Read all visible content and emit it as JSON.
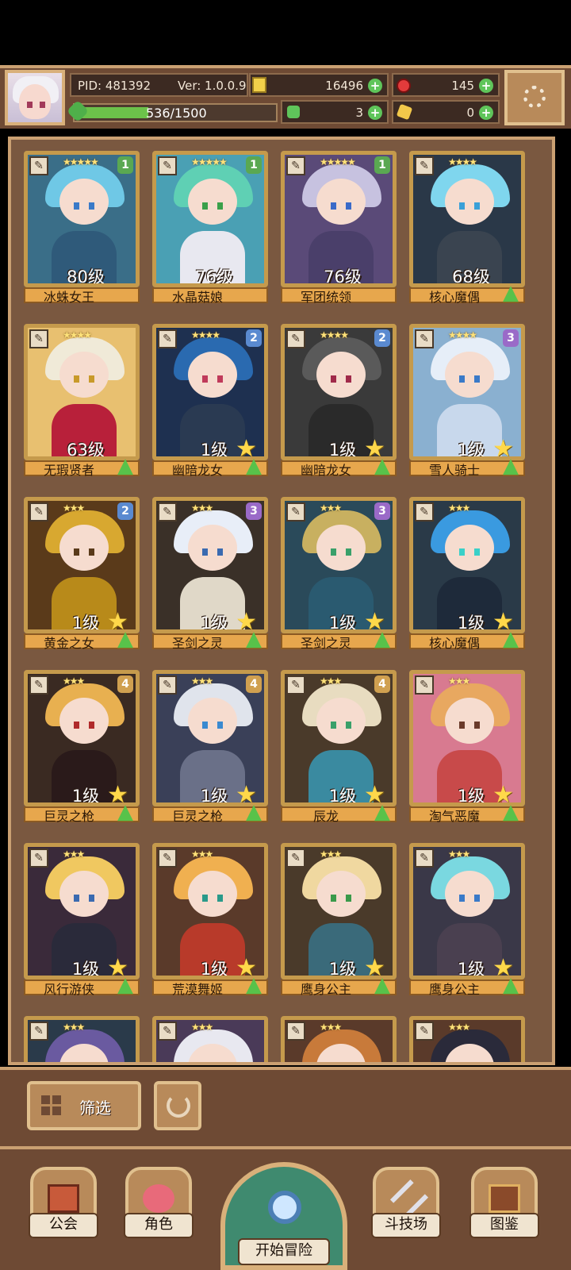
{
  "header": {
    "pid": "PID: 481392",
    "version": "Ver: 1.0.0.9",
    "gold": "16496",
    "gems": "145",
    "clover_count": "3",
    "key_count": "0",
    "exp_text": "536/1500",
    "exp_progress": 0.357
  },
  "cards": [
    {
      "name": "冰蛛女王",
      "level": "80级",
      "rank": "1",
      "rank_color": "#5aa852",
      "stars": "★★★★★",
      "hair": "#6fc8e6",
      "body": "#2f5a7a",
      "bg": "#3a6e88",
      "eye": "#3a7ac8",
      "has_star": false,
      "has_up": false
    },
    {
      "name": "水晶菇娘",
      "level": "76级",
      "rank": "1",
      "rank_color": "#5aa852",
      "stars": "★★★★★",
      "hair": "#5fd0b4",
      "body": "#e8e8f0",
      "bg": "#4aa0b4",
      "eye": "#3aa04a",
      "has_star": false,
      "has_up": false
    },
    {
      "name": "军团统领",
      "level": "76级",
      "rank": "1",
      "rank_color": "#5aa852",
      "stars": "★★★★★",
      "hair": "#c7c2e0",
      "body": "#4a3f6a",
      "bg": "#5a4a78",
      "eye": "#3a6ac8",
      "has_star": false,
      "has_up": false
    },
    {
      "name": "核心魔偶",
      "level": "68级",
      "rank": "",
      "rank_color": "",
      "stars": "★★★★",
      "hair": "#7fd6ee",
      "body": "#3a4450",
      "bg": "#2a3848",
      "eye": "#3aa0d8",
      "has_star": false,
      "has_up": true
    },
    {
      "name": "无瑕贤者",
      "level": "63级",
      "rank": "",
      "rank_color": "",
      "stars": "★★★★",
      "hair": "#f0ead8",
      "body": "#b8203a",
      "bg": "#e8c070",
      "eye": "#c89a2a",
      "has_star": false,
      "has_up": true
    },
    {
      "name": "幽暗龙女",
      "level": "1级",
      "rank": "2",
      "rank_color": "#5a8ad0",
      "stars": "★★★★",
      "hair": "#2a6ab0",
      "body": "#2a3a52",
      "bg": "#1e3050",
      "eye": "#c03a5a",
      "has_star": true,
      "has_up": true
    },
    {
      "name": "幽暗龙女",
      "level": "1级",
      "rank": "2",
      "rank_color": "#5a8ad0",
      "stars": "★★★★",
      "hair": "#5a5a5a",
      "body": "#2a2a2a",
      "bg": "#3a3a3a",
      "eye": "#a02a4a",
      "has_star": true,
      "has_up": true
    },
    {
      "name": "雪人骑士",
      "level": "1级",
      "rank": "3",
      "rank_color": "#9a6ac8",
      "stars": "★★★★",
      "hair": "#e6eef8",
      "body": "#c8d8ec",
      "bg": "#8ab0d0",
      "eye": "#3a7ac8",
      "has_star": true,
      "has_up": true
    },
    {
      "name": "黄金之女",
      "level": "1级",
      "rank": "2",
      "rank_color": "#5a8ad0",
      "stars": "★★★",
      "hair": "#d8a830",
      "body": "#b88a1a",
      "bg": "#5a3a1a",
      "eye": "#5a3a1a",
      "has_star": true,
      "has_up": true
    },
    {
      "name": "圣剑之灵",
      "level": "1级",
      "rank": "3",
      "rank_color": "#9a6ac8",
      "stars": "★★★",
      "hair": "#e8eef8",
      "body": "#e0d8c8",
      "bg": "#3a3028",
      "eye": "#3a6ab0",
      "has_star": true,
      "has_up": true
    },
    {
      "name": "圣剑之灵",
      "level": "1级",
      "rank": "3",
      "rank_color": "#9a6ac8",
      "stars": "★★★",
      "hair": "#c8b060",
      "body": "#2a5a70",
      "bg": "#2a4a5a",
      "eye": "#3aa06a",
      "has_star": true,
      "has_up": true
    },
    {
      "name": "核心魔偶",
      "level": "1级",
      "rank": "",
      "rank_color": "",
      "stars": "★★★",
      "hair": "#3a9ae0",
      "body": "#1e2a3a",
      "bg": "#2a3a48",
      "eye": "#3ad0c8",
      "has_star": true,
      "has_up": true
    },
    {
      "name": "巨灵之枪",
      "level": "1级",
      "rank": "4",
      "rank_color": "#d0a050",
      "stars": "★★★",
      "hair": "#e8b050",
      "body": "#2a1a1a",
      "bg": "#3a2a22",
      "eye": "#b02a2a",
      "has_star": true,
      "has_up": true
    },
    {
      "name": "巨灵之枪",
      "level": "1级",
      "rank": "4",
      "rank_color": "#d0a050",
      "stars": "★★★",
      "hair": "#e0e4ec",
      "body": "#6a7088",
      "bg": "#3a4058",
      "eye": "#3a8ad0",
      "has_star": true,
      "has_up": true
    },
    {
      "name": "辰龙",
      "level": "1级",
      "rank": "4",
      "rank_color": "#d0a050",
      "stars": "★★★",
      "hair": "#e8dcc0",
      "body": "#3a8aa0",
      "bg": "#4a3a2a",
      "eye": "#3aa06a",
      "has_star": true,
      "has_up": true
    },
    {
      "name": "淘气恶魔",
      "level": "1级",
      "rank": "",
      "rank_color": "",
      "stars": "★★★",
      "hair": "#e8a860",
      "body": "#c84a4a",
      "bg": "#d87a90",
      "eye": "#6a3a2a",
      "has_star": true,
      "has_up": true
    },
    {
      "name": "风行游侠",
      "level": "1级",
      "rank": "",
      "rank_color": "",
      "stars": "★★★",
      "hair": "#f0c860",
      "body": "#2a2a3a",
      "bg": "#3a2a3a",
      "eye": "#3a6ab0",
      "has_star": true,
      "has_up": true
    },
    {
      "name": "荒漠舞姬",
      "level": "1级",
      "rank": "",
      "rank_color": "",
      "stars": "★★★",
      "hair": "#f0b050",
      "body": "#b83a2a",
      "bg": "#5a3a2a",
      "eye": "#2a9a8a",
      "has_star": true,
      "has_up": true
    },
    {
      "name": "鹰身公主",
      "level": "1级",
      "rank": "",
      "rank_color": "",
      "stars": "★★★",
      "hair": "#f0d8a0",
      "body": "#3a6a7a",
      "bg": "#4a3a2a",
      "eye": "#3a9a4a",
      "has_star": true,
      "has_up": true
    },
    {
      "name": "鹰身公主",
      "level": "1级",
      "rank": "",
      "rank_color": "",
      "stars": "★★★",
      "hair": "#7ad8e0",
      "body": "#4a4050",
      "bg": "#3a3848",
      "eye": "#3a7ac8",
      "has_star": true,
      "has_up": true
    },
    {
      "name": "",
      "level": "",
      "rank": "",
      "rank_color": "",
      "stars": "★★★",
      "hair": "#6a5aa0",
      "body": "#2a2a3a",
      "bg": "#2a3a4a",
      "eye": "#3a9a6a",
      "has_star": false,
      "has_up": false
    },
    {
      "name": "",
      "level": "",
      "rank": "",
      "rank_color": "",
      "stars": "★★★",
      "hair": "#e8e8f0",
      "body": "#5a4a6a",
      "bg": "#4a3a58",
      "eye": "#5a3a7a",
      "has_star": false,
      "has_up": false
    },
    {
      "name": "",
      "level": "",
      "rank": "",
      "rank_color": "",
      "stars": "★★★",
      "hair": "#c87a3a",
      "body": "#a85a2a",
      "bg": "#5a3a2a",
      "eye": "#3a2a1a",
      "has_star": false,
      "has_up": false
    },
    {
      "name": "",
      "level": "",
      "rank": "",
      "rank_color": "",
      "stars": "★★★",
      "hair": "#2a2a3a",
      "body": "#e8c8b8",
      "bg": "#5a3a2a",
      "eye": "#3a2a1a",
      "has_star": false,
      "has_up": false
    }
  ],
  "controls": {
    "filter_label": "筛选"
  },
  "nav": {
    "guild": "公会",
    "role": "角色",
    "adventure": "开始冒险",
    "arena": "斗技场",
    "codex": "图鉴"
  }
}
